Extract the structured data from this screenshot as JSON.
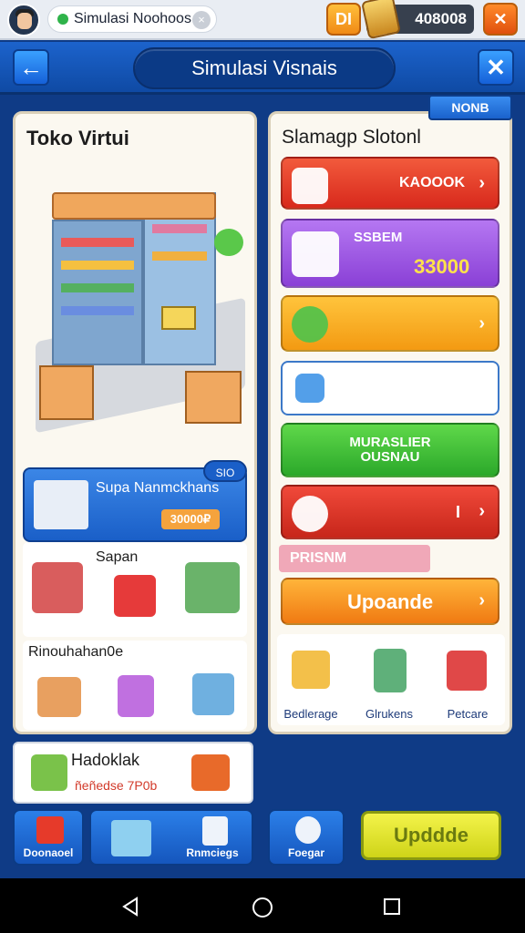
{
  "topbar": {
    "tab_title": "Simulasi Noohoos",
    "left_button_label": "DI",
    "currency_value": "408008",
    "close_label": "✕"
  },
  "title_bar": {
    "title": "Simulasi Visnais",
    "back_label": "←",
    "close_label": "✕",
    "badge": "NONB"
  },
  "left_panel": {
    "title": "Toko Virtui",
    "promo": {
      "title": "Supa Nanmckhans",
      "price": "30000₽",
      "badge": "SIO"
    },
    "section1": {
      "title": "Sapan"
    },
    "section2": {
      "title": "Rinouhahan0e"
    }
  },
  "right_panel": {
    "title": "Slamagp Slotonl",
    "buttons": [
      {
        "label": "KAOOOK",
        "color": "#e8392c"
      },
      {
        "label": "SSBEM",
        "value": "33000",
        "color": "#a059e0"
      },
      {
        "label": "",
        "color": "#f6b020"
      },
      {
        "label": "",
        "color": "#ffffff"
      },
      {
        "label": "MURASLIER OUSNAU",
        "color": "#33c23c"
      },
      {
        "label": "I",
        "color": "#e03a2a"
      }
    ],
    "tag": "PRISNM",
    "upgrade_label": "Upoande",
    "items": [
      {
        "label": "Bedlerage",
        "icon": "shopping-cart-icon"
      },
      {
        "label": "Glrukens",
        "icon": "vending-machine-icon"
      },
      {
        "label": "Petcare",
        "icon": "sofa-icon"
      }
    ]
  },
  "bottom_card": {
    "title": "Hadoklak",
    "subtitle": "ñeñedse 7P0b"
  },
  "bottom_nav": {
    "tabs": [
      {
        "label": "Doonaoel"
      },
      {
        "label": "Rnmciegs"
      },
      {
        "label": "Foegar"
      }
    ],
    "update_label": "Upddde"
  }
}
